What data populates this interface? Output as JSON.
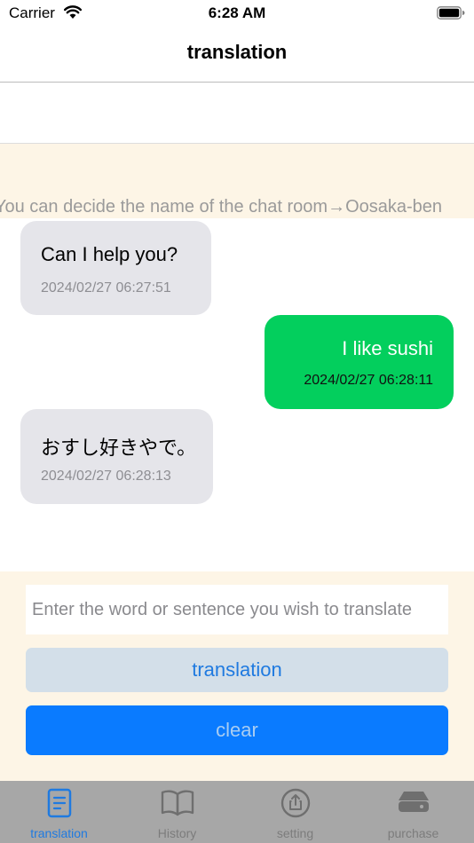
{
  "status_bar": {
    "carrier": "Carrier",
    "time": "6:28 AM"
  },
  "nav": {
    "title": "translation"
  },
  "room_name": {
    "value": ""
  },
  "banner": {
    "text": "You can decide the name of the chat room→Oosaka-ben"
  },
  "messages": [
    {
      "side": "left",
      "text": "Can I help you?",
      "timestamp": "2024/02/27 06:27:51"
    },
    {
      "side": "right",
      "text": "I like sushi",
      "timestamp": "2024/02/27 06:28:11"
    },
    {
      "side": "left",
      "text": "おすし好きやで。",
      "timestamp": "2024/02/27 06:28:13"
    }
  ],
  "input": {
    "placeholder": "Enter the word or sentence you wish to translate",
    "value": ""
  },
  "buttons": {
    "translate": "translation",
    "clear": "clear"
  },
  "tabs": [
    {
      "label": "translation",
      "icon": "document-icon",
      "active": true
    },
    {
      "label": "History",
      "icon": "book-icon",
      "active": false
    },
    {
      "label": "setting",
      "icon": "share-circle-icon",
      "active": false
    },
    {
      "label": "purchase",
      "icon": "drive-icon",
      "active": false
    }
  ],
  "colors": {
    "accent": "#1f7ae0",
    "sent_bubble": "#03cf5d",
    "received_bubble": "#e5e5ea",
    "cream": "#fdf5e6",
    "tab_bar": "#a7a7a7"
  }
}
